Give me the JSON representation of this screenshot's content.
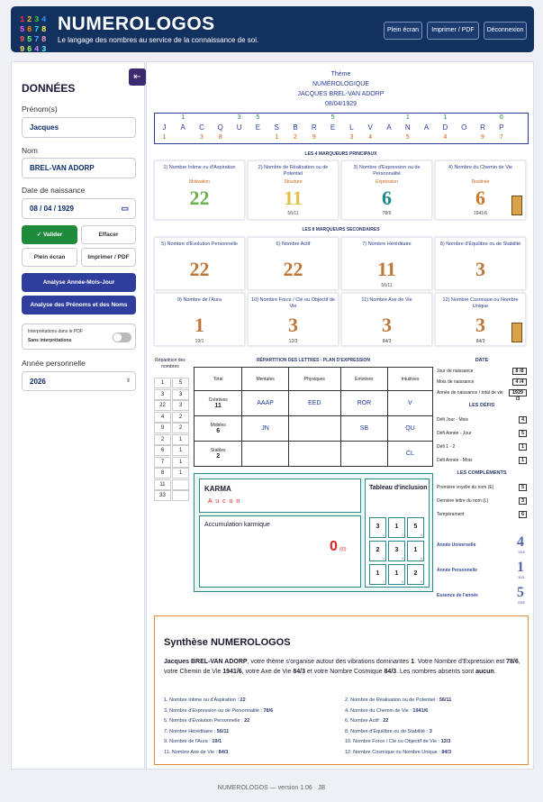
{
  "header": {
    "logo_digits": [
      "1",
      "2",
      "3",
      "4",
      "5",
      "6",
      "7",
      "8",
      "9",
      "5",
      "7",
      "8",
      "9",
      "6",
      "4",
      "3"
    ],
    "title": "NUMEROLOGOS",
    "tagline": "Le langage des nombres au service de la connaissance de soi.",
    "buttons": [
      "Plein écran",
      "Imprimer / PDF",
      "Déconnexion"
    ]
  },
  "sidebar": {
    "title": "DONNÉES",
    "prenom_label": "Prénom(s)",
    "prenom": "Jacques",
    "nom_label": "Nom",
    "nom": "BREL-VAN ADORP",
    "date_label": "Date de naissance",
    "date": "08 / 04 / 1929",
    "valider": "✓ Valider",
    "effacer": "Effacer",
    "plein": "Plein écran",
    "imprimer": "Imprimer / PDF",
    "analyse1": "Analyse Année-Mois-Jour",
    "analyse2": "Analyse des Prénoms et des Noms",
    "interp1": "Interprétations dans le PDF",
    "interp2": "Sans interprétations",
    "annee_label": "Année personnelle",
    "annee": "2026",
    "collapse_icon": "⇤"
  },
  "theme": {
    "label": "Thème",
    "type": "NUMÉROLOGIQUE",
    "name": "JACQUES BREL-VAN ADORP",
    "date": "08/04/1929"
  },
  "letters": {
    "top": [
      "",
      "1",
      "",
      "",
      "3",
      "5",
      "",
      "",
      "",
      "5",
      "",
      "",
      "",
      "1",
      "",
      "1",
      "",
      "",
      "6",
      ""
    ],
    "mid": [
      "J",
      "A",
      "C",
      "Q",
      "U",
      "E",
      "S",
      "B",
      "R",
      "E",
      "L",
      "V",
      "A",
      "N",
      "A",
      "D",
      "O",
      "R",
      "P",
      ""
    ],
    "bot": [
      "1",
      "",
      "3",
      "8",
      "",
      "",
      "1",
      "2",
      "9",
      "",
      "3",
      "4",
      "",
      "5",
      "",
      "4",
      "",
      "9",
      "7",
      ""
    ]
  },
  "principal_title": "LES 4 MARQUEURS PRINCIPAUX",
  "principal": [
    {
      "title": "1) Nombre Intime ou d'Aspiration",
      "sub": "Motivation",
      "num": "22",
      "foot": "",
      "color": "#6ab04c"
    },
    {
      "title": "2) Nombre de Réalisation ou de Potentiel",
      "sub": "Structure",
      "num": "11",
      "foot": "56/11",
      "color": "#e0c146"
    },
    {
      "title": "3) Nombre d'Expression ou de Personnalité",
      "sub": "Expression",
      "num": "6",
      "foot": "78/6",
      "color": "#1c8a8a"
    },
    {
      "title": "4) Nombre du Chemin de Vie",
      "sub": "Destinée",
      "num": "6",
      "foot": "1941/6",
      "color": "#c97a2a"
    }
  ],
  "secondary_title": "LES 8 MARQUEURS SECONDAIRES",
  "secondary": [
    {
      "title": "5) Nombre d'Évolution Personnelle",
      "num": "22",
      "foot": ""
    },
    {
      "title": "6) Nombre Actif",
      "num": "22",
      "foot": ""
    },
    {
      "title": "7) Nombre Héréditaire",
      "num": "11",
      "foot": "56/11"
    },
    {
      "title": "8) Nombre d'Équilibre ou de Stabilité",
      "num": "3",
      "foot": ""
    },
    {
      "title": "9) Nombre de l'Aura",
      "num": "1",
      "foot": "19/1"
    },
    {
      "title": "10) Nombre Force / Clé ou Objectif de Vie",
      "num": "3",
      "foot": "12/3"
    },
    {
      "title": "11) Nombre Axe de Vie",
      "num": "3",
      "foot": "84/3"
    },
    {
      "title": "12) Nombre Cosmique ou Nombre Unique",
      "num": "3",
      "foot": "84/3"
    }
  ],
  "repartition": {
    "title": "Répartition des nombres",
    "rows": [
      [
        "1",
        "5"
      ],
      [
        "3",
        "3"
      ],
      [
        "22",
        "3"
      ],
      [
        "4",
        "2"
      ],
      [
        "9",
        "2"
      ],
      [
        "2",
        "1"
      ],
      [
        "6",
        "1"
      ],
      [
        "7",
        "1"
      ],
      [
        "8",
        "1"
      ],
      [
        "11",
        ""
      ],
      [
        "33",
        ""
      ]
    ]
  },
  "plan": {
    "title": "RÉPARTITION DES LETTRES - PLAN D'EXPRESSION",
    "headers": [
      "Total",
      "Mentales",
      "Physiques",
      "Émotives",
      "Intuitives"
    ],
    "rows": [
      {
        "label": "Créatives",
        "total": "11",
        "cells": [
          "AAAP",
          "EED",
          "ROR",
          "V"
        ]
      },
      {
        "label": "Mobiles",
        "total": "6",
        "cells": [
          "JN",
          "",
          "SB",
          "QU"
        ]
      },
      {
        "label": "Stables",
        "total": "2",
        "cells": [
          "",
          "",
          "",
          "CL"
        ]
      }
    ]
  },
  "karma": {
    "title": "KARMA",
    "value": "A u c u n",
    "accum_label": "Accumulation karmique",
    "accum_value": "0",
    "accum_sub": "/(0)"
  },
  "inclusion": {
    "title": "Tableau d'inclusion",
    "cells": [
      {
        "v": "3",
        "i": "1"
      },
      {
        "v": "1",
        "i": "2"
      },
      {
        "v": "5",
        "i": "3"
      },
      {
        "v": "2",
        "i": "4"
      },
      {
        "v": "3",
        "i": "5"
      },
      {
        "v": "1",
        "i": "6"
      },
      {
        "v": "1",
        "i": "7"
      },
      {
        "v": "1",
        "i": "8"
      },
      {
        "v": "2",
        "i": "9"
      }
    ]
  },
  "date_panel": {
    "title": "DATE",
    "rows": [
      {
        "l": "Jour de naissance",
        "v": "8 /8"
      },
      {
        "l": "Mois de naissance",
        "v": "4 /4"
      },
      {
        "l": "Année de naissance / total de vie",
        "v": "1929 /3"
      }
    ]
  },
  "defis": {
    "title": "LES DÉFIS",
    "rows": [
      {
        "l": "Défi Jour - Mois",
        "v": "4"
      },
      {
        "l": "Défi Année - Jour",
        "v": "5"
      },
      {
        "l": "Défi 1 - 2",
        "v": "1"
      },
      {
        "l": "Défi Année - Mois",
        "v": "1"
      }
    ]
  },
  "complements": {
    "title": "LES COMPLÉMENTS",
    "rows": [
      {
        "l": "Première voyelle du nom (E)",
        "v": "5"
      },
      {
        "l": "Dernière lettre du nom (L)",
        "v": "3"
      },
      {
        "l": "Tempérament",
        "v": "6"
      }
    ],
    "big": [
      {
        "l": "Année Universelle",
        "v": "4",
        "f": "13/4"
      },
      {
        "l": "Année Personnelle",
        "v": "1",
        "f": "10/1"
      },
      {
        "l": "Essence de l'année",
        "v": "5",
        "f": "23/5"
      }
    ]
  },
  "synthese": {
    "title": "Synthèse NUMEROLOGOS",
    "name": "Jacques BREL-VAN ADORP",
    "p1": ", votre thème s'organise autour des vibrations dominantes ",
    "v1": "1",
    "p2": ". Votre Nombre d'Expression est ",
    "v2": "78/6",
    "p3": ", votre Chemin de Vie ",
    "v3": "1941/6",
    "p4": ", votre Axe de Vie ",
    "v4": "84/3",
    "p5": " et votre Nombre Cosmique ",
    "v5": "84/3",
    "p6": ". Les nombres absents sont ",
    "v6": "aucun",
    "p7": ".",
    "list": [
      [
        "1. Nombre Intime ou d'Aspiration : ",
        "22"
      ],
      [
        "2. Nombre de Réalisation ou de Potentiel : ",
        "56/11"
      ],
      [
        "3. Nombre d'Expression ou de Personnalité : ",
        "78/6"
      ],
      [
        "4. Nombre du Chemin de Vie : ",
        "1941/6"
      ],
      [
        "5. Nombre d'Évolution Personnelle : ",
        "22"
      ],
      [
        "6. Nombre Actif : ",
        "22"
      ],
      [
        "7. Nombre Héréditaire : ",
        "56/11"
      ],
      [
        "8. Nombre d'Équilibre ou de Stabilité : ",
        "3"
      ],
      [
        "9. Nombre de l'Aura : ",
        "19/1"
      ],
      [
        "10. Nombre Force / Clé ou Objectif de Vie : ",
        "12/3"
      ],
      [
        "11. Nombre Axe de Vie : ",
        "84/3"
      ],
      [
        "12. Nombre Cosmique ou Nombre Unique : ",
        "84/3"
      ]
    ]
  },
  "footer": "NUMEROLOGOS — version 1.06 · JB"
}
